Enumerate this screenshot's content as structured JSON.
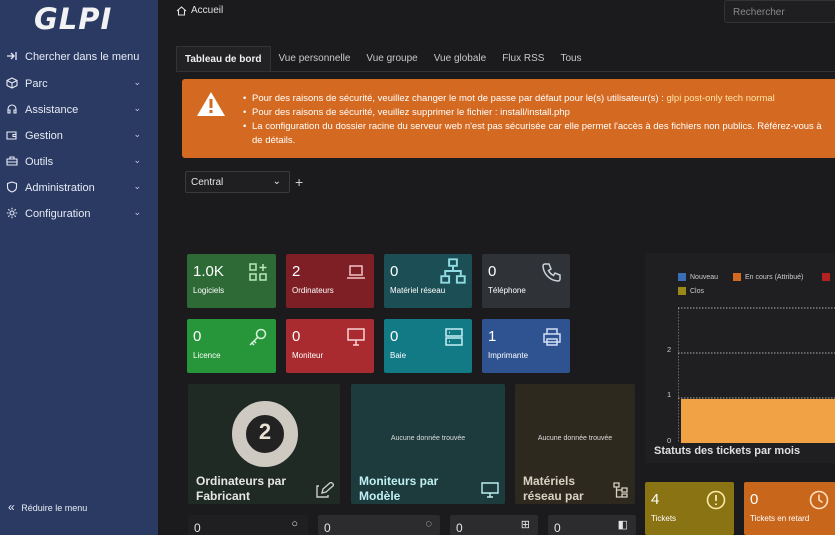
{
  "app": {
    "logo_text": "GLPI"
  },
  "sidebar": {
    "items": [
      {
        "label": "Chercher dans le menu",
        "icon": "search-arrow-icon",
        "chevron": false
      },
      {
        "label": "Parc",
        "icon": "box-icon",
        "chevron": true
      },
      {
        "label": "Assistance",
        "icon": "headset-icon",
        "chevron": true
      },
      {
        "label": "Gestion",
        "icon": "wallet-icon",
        "chevron": true
      },
      {
        "label": "Outils",
        "icon": "briefcase-icon",
        "chevron": true
      },
      {
        "label": "Administration",
        "icon": "shield-icon",
        "chevron": true
      },
      {
        "label": "Configuration",
        "icon": "gear-icon",
        "chevron": true
      }
    ],
    "collapse_label": "Réduire le menu"
  },
  "header": {
    "breadcrumb": "Accueil",
    "search_placeholder": "Rechercher"
  },
  "tabs": [
    {
      "label": "Tableau de bord",
      "active": true
    },
    {
      "label": "Vue personnelle",
      "active": false
    },
    {
      "label": "Vue groupe",
      "active": false
    },
    {
      "label": "Vue globale",
      "active": false
    },
    {
      "label": "Flux RSS",
      "active": false
    },
    {
      "label": "Tous",
      "active": false
    }
  ],
  "alert": {
    "line1_text": "Pour des raisons de sécurité, veuillez changer le mot de passe par défaut pour le(s) utilisateur(s) : ",
    "line1_link": "glpi post-only tech normal",
    "line2": "Pour des raisons de sécurité, veuillez supprimer le fichier : install/install.php",
    "line3a": "La configuration du dossier racine du serveur web n'est pas sécurisée car elle permet l'accès à des fichiers non publics. Référez-vous à",
    "line3b": "de détails.",
    "color": "#d46a21"
  },
  "dashboard": {
    "selected": "Central",
    "cards": [
      {
        "value": "1.0K",
        "label": "Logiciels",
        "color": "#2d6a35",
        "icon": "apps-add-icon"
      },
      {
        "value": "2",
        "label": "Ordinateurs",
        "color": "#7d1f24",
        "icon": "laptop-icon"
      },
      {
        "value": "0",
        "label": "Matériel réseau",
        "color": "#1b4f55",
        "icon": "network-icon"
      },
      {
        "value": "0",
        "label": "Téléphone",
        "color": "#2f3338",
        "icon": "phone-icon"
      },
      {
        "value": "0",
        "label": "Licence",
        "color": "#27963a",
        "icon": "key-icon"
      },
      {
        "value": "0",
        "label": "Moniteur",
        "color": "#a92b2f",
        "icon": "monitor-icon"
      },
      {
        "value": "0",
        "label": "Baie",
        "color": "#117a85",
        "icon": "server-icon"
      },
      {
        "value": "1",
        "label": "Imprimante",
        "color": "#2e5390",
        "icon": "printer-icon"
      }
    ],
    "widgets": [
      {
        "title_line1": "Ordinateurs par",
        "title_line2": "Fabricant",
        "big_number": "2",
        "bg": "#1f2a24"
      },
      {
        "title_line1": "Moniteurs par",
        "title_line2": "Modèle",
        "nodata": "Aucune donnée trouvée",
        "bg": "#1d3a3c"
      },
      {
        "title_line1": "Matériels",
        "title_line2": "réseau par",
        "nodata": "Aucune donnée trouvée",
        "bg": "#2e291f"
      }
    ],
    "ticket_chart": {
      "title": "Statuts des tickets par mois",
      "legend": [
        {
          "name": "Nouveau",
          "color": "#3a6fb5"
        },
        {
          "name": "En cours (Attribué)",
          "color": "#d46a21"
        },
        {
          "name": "",
          "color": "#b52020"
        },
        {
          "name": "Clos",
          "color": "#9a8a1a"
        }
      ],
      "y_ticks": [
        "2",
        "1",
        "0"
      ],
      "bar_color": "#f1a244"
    },
    "ticket_cards": [
      {
        "value": "4",
        "label": "Tickets",
        "color": "#8a7312",
        "icon": "alert-circle-icon"
      },
      {
        "value": "0",
        "label": "Tickets en retard",
        "color": "#c8661b",
        "icon": "clock-icon"
      }
    ],
    "bottom_values": [
      "0",
      "0",
      "0",
      "0"
    ]
  }
}
